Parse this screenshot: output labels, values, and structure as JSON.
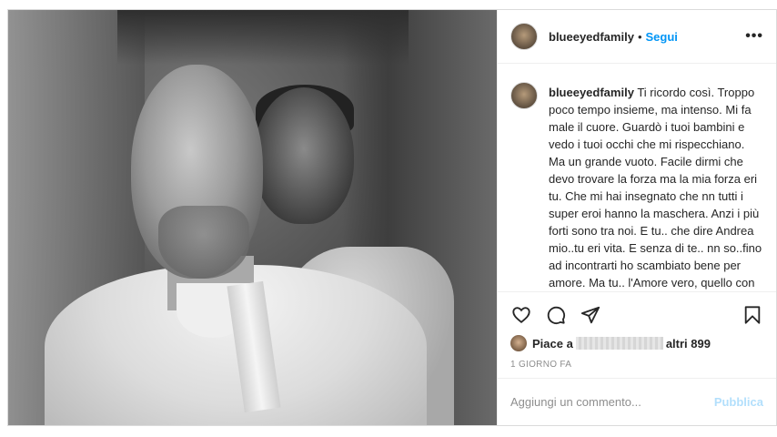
{
  "header": {
    "username": "blueeyedfamily",
    "separator": "•",
    "follow_label": "Segui",
    "more_label": "•••"
  },
  "caption": {
    "username": "blueeyedfamily",
    "text": "Ti ricordo così. Troppo poco tempo insieme, ma intenso. Mi fa male il cuore. Guardò i tuoi bambini e vedo i tuoi occhi che mi rispecchiano. Ma un grande vuoto. Facile dirmi che devo trovare la forza ma la mia forza eri tu. Che mi hai insegnato che nn tutti i super eroi hanno la maschera. Anzi i più forti sono tra noi. E tu.. che dire Andrea mio..tu eri vita. E senza di te.. nn so..fino ad incontrarti ho scambiato bene per amore. Ma tu.. l'Amore vero, quello con la A maiuscola. Ti amo tutto il resto è superfluo. Sei la mia vita, ti ho"
  },
  "actions": {
    "like_icon": "heart-icon",
    "comment_icon": "comment-icon",
    "share_icon": "share-icon",
    "save_icon": "bookmark-icon"
  },
  "likes": {
    "prefix": "Piace a",
    "suffix": "altri 899"
  },
  "timestamp": "1 GIORNO FA",
  "comment_box": {
    "placeholder": "Aggiungi un commento...",
    "post_label": "Pubblica"
  }
}
